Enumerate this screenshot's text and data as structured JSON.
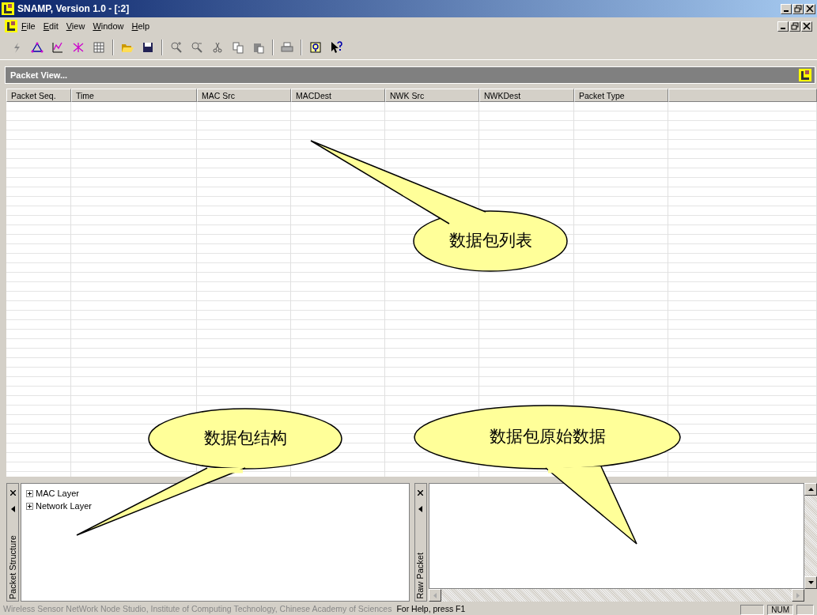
{
  "window": {
    "title": "SNAMP, Version 1.0 - [:2]"
  },
  "menu": [
    "File",
    "Edit",
    "View",
    "Window",
    "Help"
  ],
  "packet_view": {
    "title": "Packet View..."
  },
  "table": {
    "columns": [
      "Packet Seq.",
      "Time",
      "MAC Src",
      "MACDest",
      "NWK Src",
      "NWKDest",
      "Packet Type"
    ]
  },
  "packet_structure": {
    "title": "Packet Structure",
    "tree": [
      {
        "label": "MAC Layer",
        "expanded": false
      },
      {
        "label": "Network Layer",
        "expanded": false
      }
    ]
  },
  "raw_packet": {
    "title": "Raw Packet"
  },
  "callouts": [
    {
      "text": "数据包列表"
    },
    {
      "text": "数据包结构"
    },
    {
      "text": "数据包原始数据"
    }
  ],
  "status_bar": {
    "credit": "Wireless Sensor NetWork Node Studio, Institute of Computing Technology, Chinese Academy of Sciences",
    "help": "For Help, press F1",
    "indicators": [
      "NUM"
    ]
  }
}
